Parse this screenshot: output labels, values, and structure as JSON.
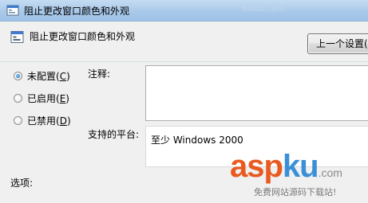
{
  "window": {
    "title": "阻止更改窗口颜色和外观",
    "title_watermark": "baidu.com"
  },
  "header": {
    "title": "阻止更改窗口颜色和外观",
    "prev_button_label": "上一个设置(P)"
  },
  "options": [
    {
      "label": "未配置",
      "accel": "C",
      "checked": true
    },
    {
      "label": "已启用",
      "accel": "E",
      "checked": false
    },
    {
      "label": "已禁用",
      "accel": "D",
      "checked": false
    }
  ],
  "fields": {
    "comment_label": "注释:",
    "comment_value": "",
    "platform_label": "支持的平台:",
    "platform_value": "至少 Windows 2000",
    "options_label": "选项:"
  },
  "watermark": {
    "part1": "asp",
    "part2": "ku",
    "domain": ".com",
    "subtitle": "免费网站源码下载站!"
  },
  "colors": {
    "titlebar": "#a9c9ea",
    "window_bg": "#f0f0f0",
    "logo_orange": "#e85a1f",
    "logo_blue": "#3a8fd8"
  }
}
